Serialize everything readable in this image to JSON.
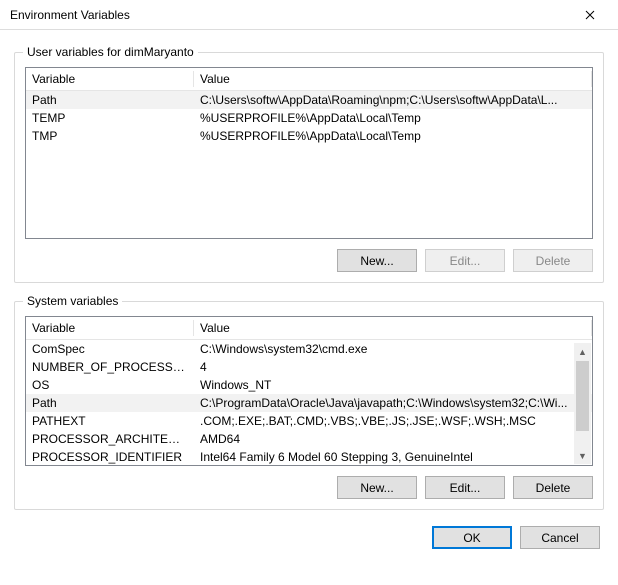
{
  "window": {
    "title": "Environment Variables"
  },
  "user_section": {
    "legend": "User variables for dimMaryanto",
    "columns": {
      "variable": "Variable",
      "value": "Value"
    },
    "rows": [
      {
        "variable": "Path",
        "value": "C:\\Users\\softw\\AppData\\Roaming\\npm;C:\\Users\\softw\\AppData\\L..."
      },
      {
        "variable": "TEMP",
        "value": "%USERPROFILE%\\AppData\\Local\\Temp"
      },
      {
        "variable": "TMP",
        "value": "%USERPROFILE%\\AppData\\Local\\Temp"
      }
    ],
    "selected_index": 0,
    "buttons": {
      "new": "New...",
      "edit": "Edit...",
      "delete": "Delete"
    },
    "edit_enabled": false,
    "delete_enabled": false
  },
  "system_section": {
    "legend": "System variables",
    "columns": {
      "variable": "Variable",
      "value": "Value"
    },
    "rows": [
      {
        "variable": "ComSpec",
        "value": "C:\\Windows\\system32\\cmd.exe"
      },
      {
        "variable": "NUMBER_OF_PROCESSORS",
        "value": "4"
      },
      {
        "variable": "OS",
        "value": "Windows_NT"
      },
      {
        "variable": "Path",
        "value": "C:\\ProgramData\\Oracle\\Java\\javapath;C:\\Windows\\system32;C:\\Wi..."
      },
      {
        "variable": "PATHEXT",
        "value": ".COM;.EXE;.BAT;.CMD;.VBS;.VBE;.JS;.JSE;.WSF;.WSH;.MSC"
      },
      {
        "variable": "PROCESSOR_ARCHITECTURE",
        "value": "AMD64"
      },
      {
        "variable": "PROCESSOR_IDENTIFIER",
        "value": "Intel64 Family 6 Model 60 Stepping 3, GenuineIntel"
      }
    ],
    "selected_index": 3,
    "buttons": {
      "new": "New...",
      "edit": "Edit...",
      "delete": "Delete"
    },
    "edit_enabled": true,
    "delete_enabled": true
  },
  "footer": {
    "ok": "OK",
    "cancel": "Cancel"
  }
}
